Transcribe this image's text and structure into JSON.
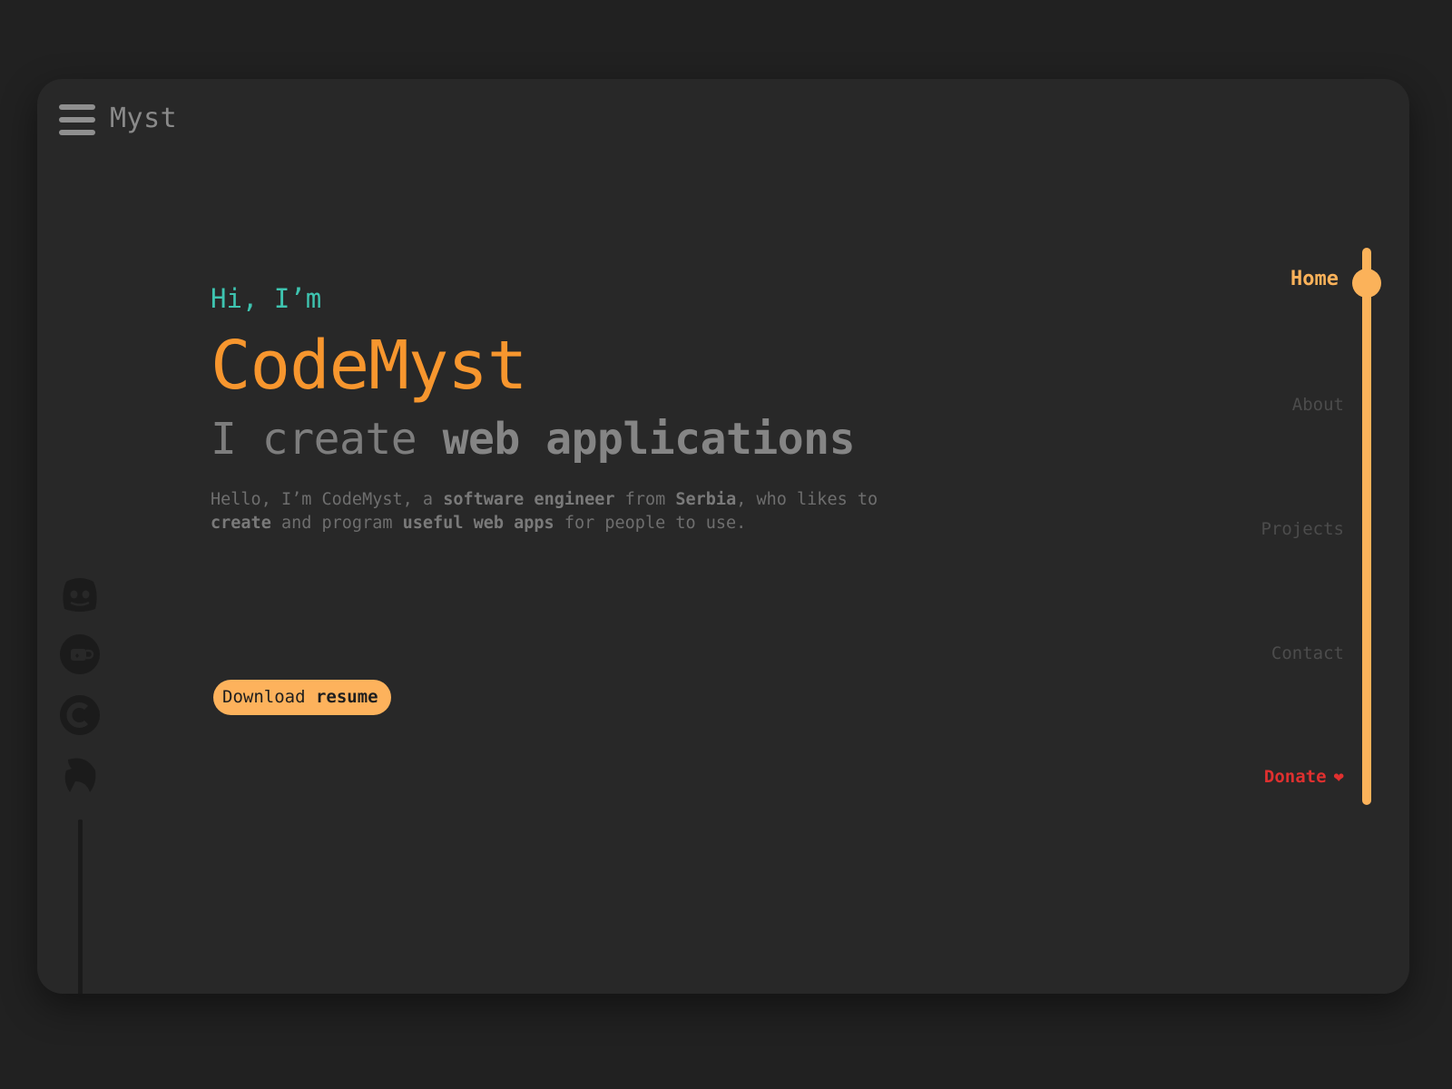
{
  "header": {
    "brand": "Myst"
  },
  "hero": {
    "greeting": "Hi, I’m",
    "name": "CodeMyst",
    "tagline_prefix": "I create ",
    "tagline_bold": "web applications",
    "bio": {
      "p1": "Hello, I’m CodeMyst, a ",
      "b1": "software engineer",
      "p2": " from ",
      "b2": "Serbia",
      "p3": ", who likes to ",
      "b3": "create",
      "p4": " and program ",
      "b4": "useful web apps",
      "p5": " for people to use."
    },
    "resume_button": {
      "prefix": "Download ",
      "bold": "resume"
    }
  },
  "social": [
    {
      "icon": "discord-icon"
    },
    {
      "icon": "ko-fi-icon"
    },
    {
      "icon": "codeberg-icon"
    },
    {
      "icon": "mastodon-icon"
    }
  ],
  "nav": {
    "items": [
      {
        "label": "Home",
        "active": true
      },
      {
        "label": "About"
      },
      {
        "label": "Projects"
      },
      {
        "label": "Contact"
      },
      {
        "label": "Donate",
        "icon": "heart-icon"
      }
    ]
  },
  "colors": {
    "background": "#212121",
    "card": "#282828",
    "accent_orange": "#f7962e",
    "accent_yellow": "#fbb25a",
    "accent_teal": "#3ec4b0",
    "donate_red": "#e0302f"
  }
}
